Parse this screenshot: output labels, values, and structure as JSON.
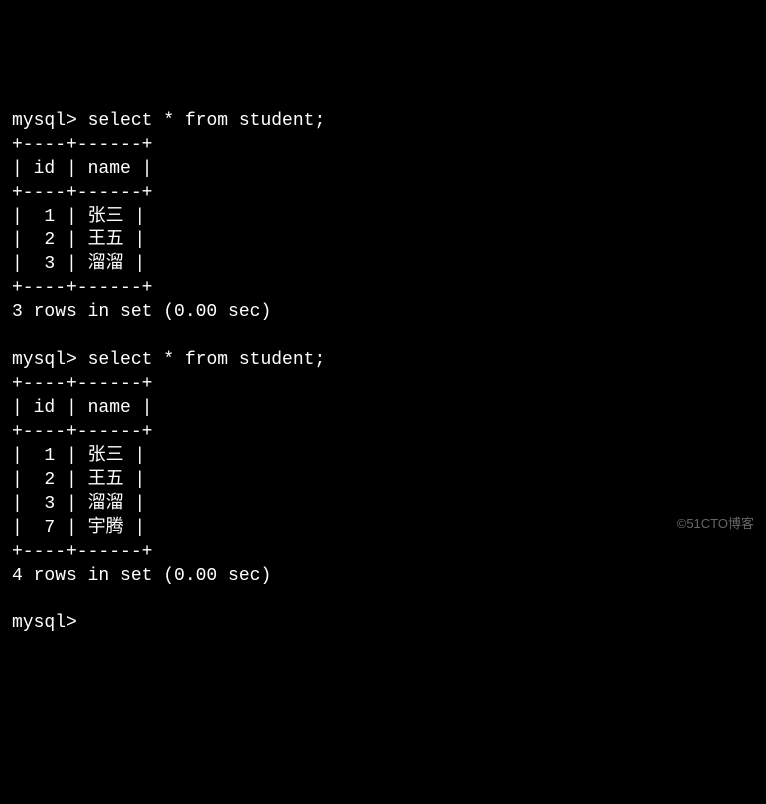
{
  "prompt": "mysql>",
  "queries": [
    {
      "sql": "select * from student;",
      "separator": "+----+------+",
      "header": "| id | name |",
      "rows": [
        "|  1 | 张三 |",
        "|  2 | 王五 |",
        "|  3 | 溜溜 |"
      ],
      "footer": "3 rows in set (0.00 sec)"
    },
    {
      "sql": "select * from student;",
      "separator": "+----+------+",
      "header": "| id | name |",
      "rows": [
        "|  1 | 张三 |",
        "|  2 | 王五 |",
        "|  3 | 溜溜 |",
        "|  7 | 宇腾 |"
      ],
      "footer": "4 rows in set (0.00 sec)"
    }
  ],
  "watermark": "©51CTO博客",
  "chart_data": {
    "type": "table",
    "queries": [
      {
        "columns": [
          "id",
          "name"
        ],
        "rows": [
          {
            "id": 1,
            "name": "张三"
          },
          {
            "id": 2,
            "name": "王五"
          },
          {
            "id": 3,
            "name": "溜溜"
          }
        ],
        "row_count": 3,
        "time_sec": 0.0
      },
      {
        "columns": [
          "id",
          "name"
        ],
        "rows": [
          {
            "id": 1,
            "name": "张三"
          },
          {
            "id": 2,
            "name": "王五"
          },
          {
            "id": 3,
            "name": "溜溜"
          },
          {
            "id": 7,
            "name": "宇腾"
          }
        ],
        "row_count": 4,
        "time_sec": 0.0
      }
    ]
  }
}
